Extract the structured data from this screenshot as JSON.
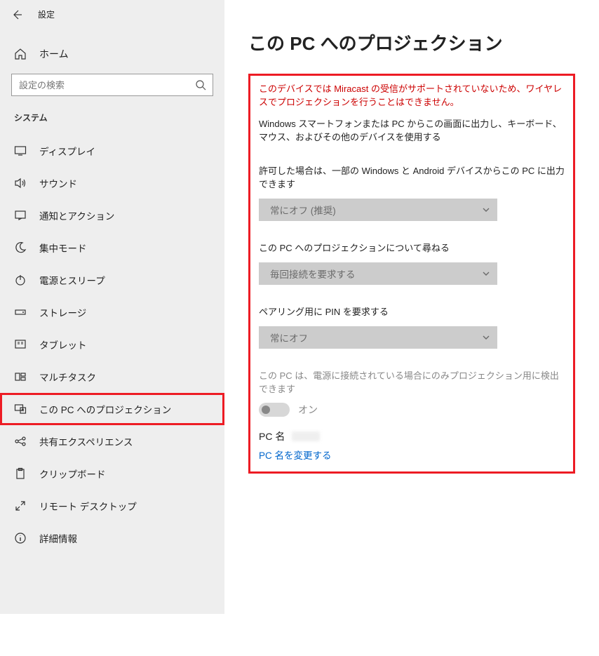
{
  "header": {
    "settings_label": "設定"
  },
  "home": {
    "label": "ホーム"
  },
  "search": {
    "placeholder": "設定の検索"
  },
  "group": {
    "label": "システム"
  },
  "nav": {
    "items": [
      {
        "key": "display",
        "label": "ディスプレイ"
      },
      {
        "key": "sound",
        "label": "サウンド"
      },
      {
        "key": "notif",
        "label": "通知とアクション"
      },
      {
        "key": "focus",
        "label": "集中モード"
      },
      {
        "key": "power",
        "label": "電源とスリープ"
      },
      {
        "key": "storage",
        "label": "ストレージ"
      },
      {
        "key": "tablet",
        "label": "タブレット"
      },
      {
        "key": "multitask",
        "label": "マルチタスク"
      },
      {
        "key": "project",
        "label": "この PC へのプロジェクション"
      },
      {
        "key": "shared",
        "label": "共有エクスペリエンス"
      },
      {
        "key": "clipboard",
        "label": "クリップボード"
      },
      {
        "key": "rdp",
        "label": "リモート デスクトップ"
      },
      {
        "key": "about",
        "label": "詳細情報"
      }
    ]
  },
  "page": {
    "title": "この PC へのプロジェクション",
    "warning": "このデバイスでは Miracast の受信がサポートされていないため、ワイヤレスでプロジェクションを行うことはできません。",
    "description": "Windows スマートフォンまたは PC からこの画面に出力し、キーボード、マウス、およびその他のデバイスを使用する",
    "field1_label": "許可した場合は、一部の Windows と Android デバイスからこの PC に出力できます",
    "field1_value": "常にオフ (推奨)",
    "field2_label": "この PC へのプロジェクションについて尋ねる",
    "field2_value": "毎回接続を要求する",
    "field3_label": "ペアリング用に PIN を要求する",
    "field3_value": "常にオフ",
    "toggle_caption": "この PC は、電源に接続されている場合にのみプロジェクション用に検出できます",
    "toggle_state": "オン",
    "pcname_label": "PC 名",
    "rename_link": "PC 名を変更する"
  }
}
